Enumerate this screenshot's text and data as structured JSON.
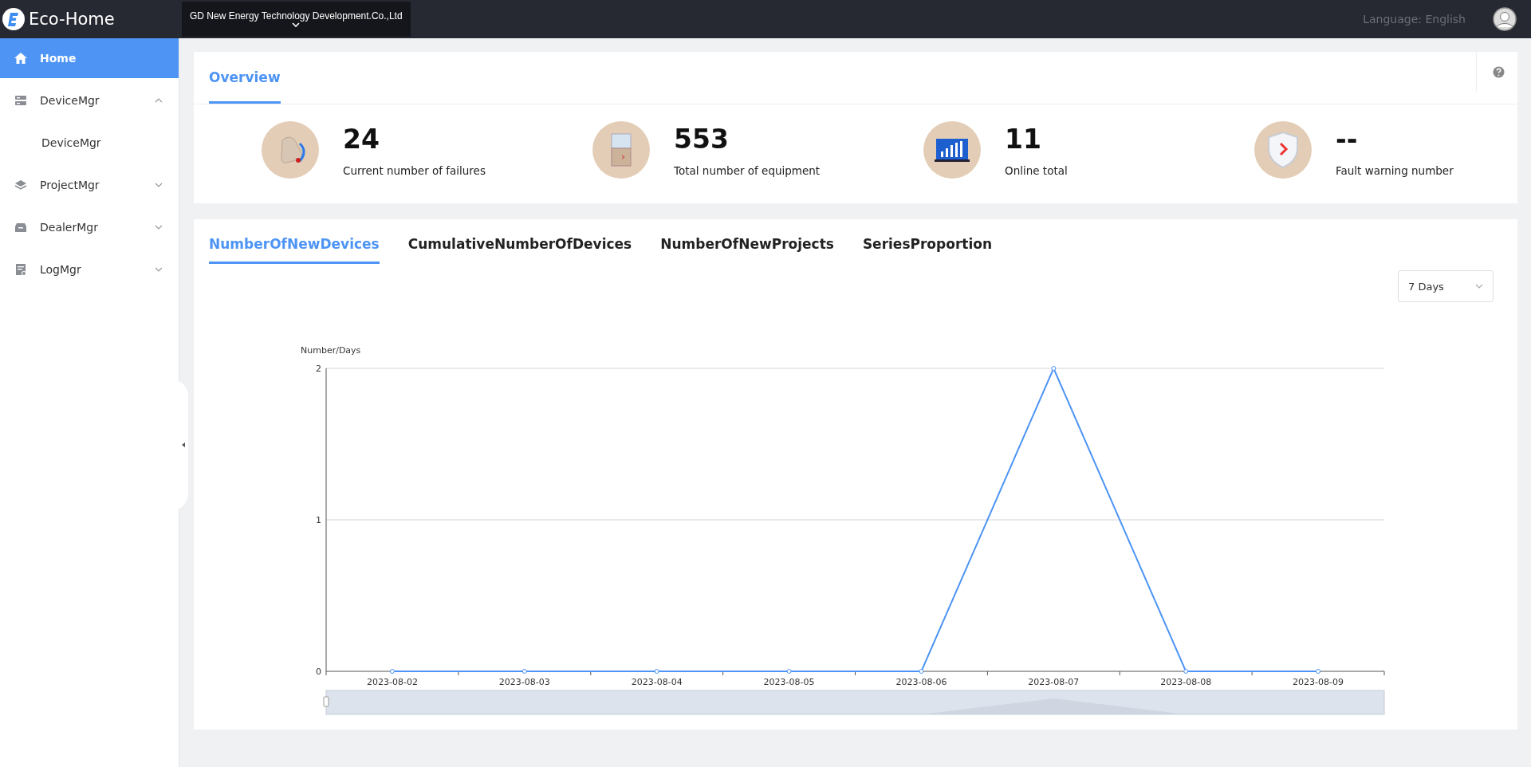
{
  "topbar": {
    "logo": "Eco-Home",
    "company": "GD New Energy Technology Development.Co.,Ltd",
    "language_label": "Language:",
    "language": "English"
  },
  "sidebar": {
    "items": [
      {
        "label": "Home",
        "selected": true
      },
      {
        "label": "DeviceMgr",
        "selected": false,
        "expanded": true,
        "children": [
          {
            "label": "DeviceMgr",
            "selected": false
          }
        ]
      },
      {
        "label": "ProjectMgr",
        "selected": false,
        "expanded": false
      },
      {
        "label": "DealerMgr",
        "selected": false,
        "expanded": false
      },
      {
        "label": "LogMgr",
        "selected": false,
        "expanded": false
      }
    ]
  },
  "overview": {
    "title": "Overview",
    "stats": [
      {
        "value": "24",
        "label": "Current number of failures"
      },
      {
        "value": "553",
        "label": "Total number of equipment"
      },
      {
        "value": "11",
        "label": "Online total"
      },
      {
        "value": "--",
        "label": "Fault warning number"
      }
    ]
  },
  "trend": {
    "tabs": [
      {
        "label": "NumberOfNewDevices",
        "selected": true
      },
      {
        "label": "CumulativeNumberOfDevices",
        "selected": false
      },
      {
        "label": "NumberOfNewProjects",
        "selected": false
      },
      {
        "label": "SeriesProportion",
        "selected": false
      }
    ],
    "range": "7 Days",
    "chart_data": {
      "type": "line",
      "ylabel": "Number/Days",
      "categories": [
        "2023-08-02",
        "2023-08-03",
        "2023-08-04",
        "2023-08-05",
        "2023-08-06",
        "2023-08-07",
        "2023-08-08",
        "2023-08-09"
      ],
      "ylim": [
        0,
        2
      ],
      "yticks": [
        0,
        1,
        2
      ],
      "series": [
        {
          "color": "#4d94f5",
          "marker": "circle",
          "values": [
            0,
            0,
            0,
            0,
            0,
            2,
            0,
            0
          ]
        }
      ]
    }
  }
}
